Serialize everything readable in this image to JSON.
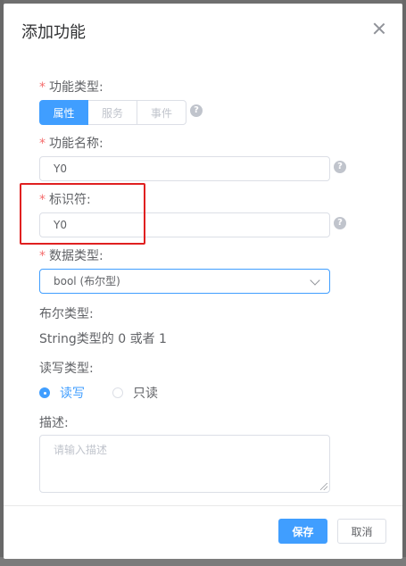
{
  "dialog": {
    "title": "添加功能",
    "close_icon": "close-icon"
  },
  "form": {
    "function_type": {
      "label": "功能类型:",
      "options": [
        "属性",
        "服务",
        "事件"
      ],
      "selected": "属性",
      "help_icon": "question-circle-icon"
    },
    "function_name": {
      "label": "功能名称:",
      "value": "Y0",
      "help_icon": "question-circle-icon"
    },
    "identifier": {
      "label": "标识符:",
      "value": "Y0",
      "help_icon": "question-circle-icon"
    },
    "data_type": {
      "label": "数据类型:",
      "selected": "bool (布尔型)",
      "arrow_icon": "chevron-down-icon"
    },
    "bool_type": {
      "label": "布尔类型:",
      "value": "String类型的 0 或者 1"
    },
    "rw_type": {
      "label": "读写类型:",
      "options": [
        "读写",
        "只读"
      ],
      "selected": "读写"
    },
    "description": {
      "label": "描述:",
      "placeholder": "请输入描述"
    }
  },
  "footer": {
    "save_label": "保存",
    "cancel_label": "取消"
  },
  "colors": {
    "primary": "#409eff",
    "required": "#f56c6c",
    "annotation": "#e02020"
  }
}
